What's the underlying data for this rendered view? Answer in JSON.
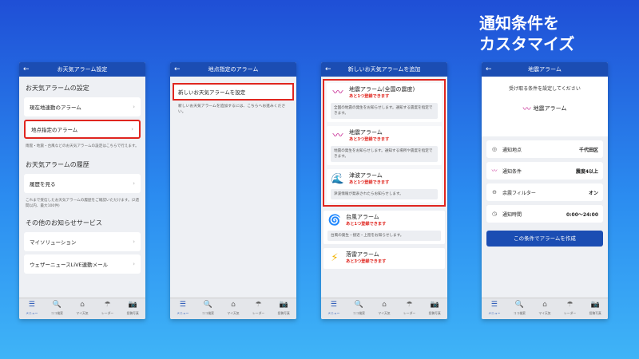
{
  "headline": {
    "line1": "通知条件を",
    "line2": "カスタマイズ"
  },
  "tabbar": [
    {
      "label": "メニュー",
      "icon": "menu-icon",
      "glyph": "☰"
    },
    {
      "label": "ココ検索",
      "icon": "search-icon",
      "glyph": "🔍"
    },
    {
      "label": "マイ天気",
      "icon": "home-icon",
      "glyph": "⌂"
    },
    {
      "label": "レーダー",
      "icon": "radar-icon",
      "glyph": "☂"
    },
    {
      "label": "投稿写真",
      "icon": "camera-icon",
      "glyph": "📷"
    }
  ],
  "screen1": {
    "title": "お天気アラーム設定",
    "section1": "お天気アラームの設定",
    "item_current": "現在地連動のアラーム",
    "item_point": "地点指定のアラーム",
    "note1": "雨雲・地震・台風などのお天気アラームの設定はこちらで行えます。",
    "section2": "お天気アラームの履歴",
    "item_history": "履歴を見る",
    "note2": "これまで受信したお天気アラームの履歴をご確認いただけます。(2週間以内、最大100件)",
    "section3": "その他のお知らせサービス",
    "item_my": "マイソリューション",
    "item_live": "ウェザーニュースLiVE連動メール"
  },
  "screen2": {
    "title": "地点指定のアラーム",
    "new_alarm": "新しいお天気アラームを設定",
    "desc": "新しいお天気アラームを追加するには、こちらへお進みください。"
  },
  "screen3": {
    "title": "新しいお天気アラームを追加",
    "alarms": [
      {
        "name": "地震アラーム(全国の震度)",
        "remain": "あと1つ登録できます",
        "info": "全国の地震の発生をお知らせします。通知する震度を指定できます。",
        "icon": "seismic-wave-icon",
        "glyph": "〰",
        "color": "#c2188b"
      },
      {
        "name": "地震アラーム",
        "remain": "あと3つ登録できます",
        "info": "地震の発生をお知らせします。通知する場所や震度を指定できます。",
        "icon": "seismic-wave-icon",
        "glyph": "〰",
        "color": "#c2188b"
      },
      {
        "name": "津波アラーム",
        "remain": "あと1つ登録できます",
        "info": "津波情報が発表されたらお知らせします。",
        "icon": "tsunami-wave-icon",
        "glyph": "🌊",
        "color": "#2f8fe0"
      },
      {
        "name": "台風アラーム",
        "remain": "あと1つ登録できます",
        "info": "台風の発生・接近・上陸をお知らせします。",
        "icon": "typhoon-icon",
        "glyph": "🌀",
        "color": "#8d3fd0"
      },
      {
        "name": "落雷アラーム",
        "remain": "あと3つ登録できます",
        "info": "",
        "icon": "lightning-icon",
        "glyph": "⚡",
        "color": "#f2b300"
      }
    ]
  },
  "screen4": {
    "title": "地震アラーム",
    "prompt": "受け取る条件を設定してください",
    "alarm_type": "地震アラーム",
    "rows": [
      {
        "label": "通知地点",
        "value": "千代田区",
        "icon": "location-icon",
        "glyph": "◎"
      },
      {
        "label": "通知条件",
        "value": "震度4以上",
        "icon": "seismic-wave-icon",
        "glyph": "〰"
      },
      {
        "label": "余震フィルター",
        "value": "オン",
        "icon": "filter-icon",
        "glyph": "⊖"
      },
      {
        "label": "通知時間",
        "value": "0:00〜24:00",
        "icon": "clock-icon",
        "glyph": "◷"
      }
    ],
    "create_button": "この条件でアラームを作成"
  }
}
